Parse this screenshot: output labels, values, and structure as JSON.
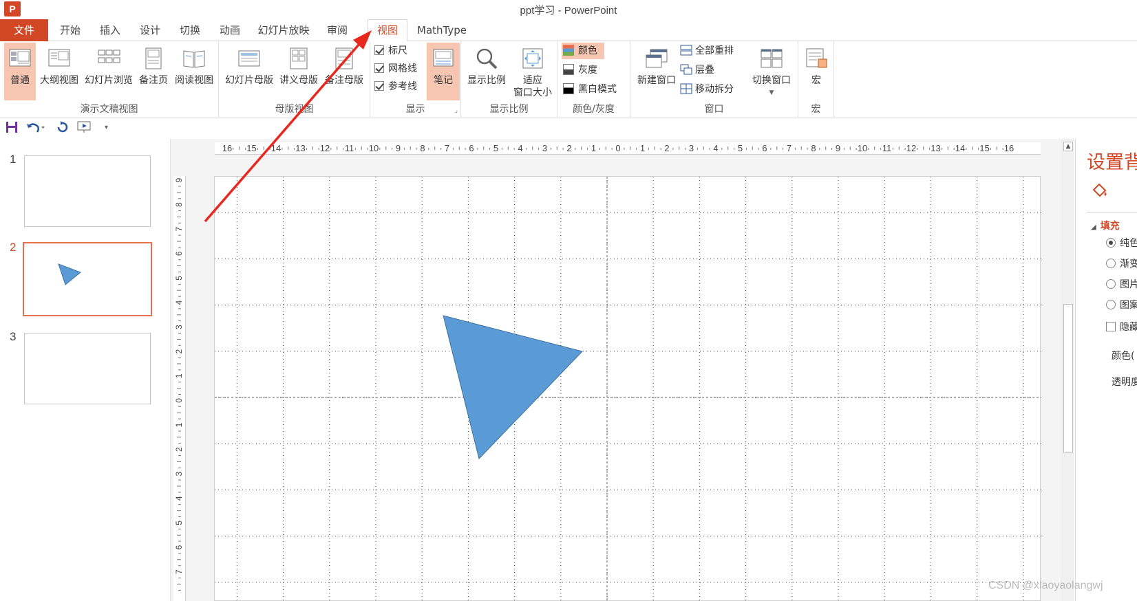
{
  "window": {
    "title": "ppt学习 - PowerPoint",
    "logo": "P"
  },
  "tabs": [
    {
      "label": "文件"
    },
    {
      "label": "开始"
    },
    {
      "label": "插入"
    },
    {
      "label": "设计"
    },
    {
      "label": "切换"
    },
    {
      "label": "动画"
    },
    {
      "label": "幻灯片放映"
    },
    {
      "label": "审阅"
    },
    {
      "label": "视图"
    },
    {
      "label": "MathType"
    }
  ],
  "active_tab": "视图",
  "ribbon": {
    "presentation_views": {
      "label": "演示文稿视图",
      "buttons": [
        "普通",
        "大纲视图",
        "幻灯片浏览",
        "备注页",
        "阅读视图"
      ]
    },
    "master_views": {
      "label": "母版视图",
      "buttons": [
        "幻灯片母版",
        "讲义母版",
        "备注母版"
      ]
    },
    "show": {
      "label": "显示",
      "checks": [
        "标尺",
        "网格线",
        "参考线"
      ],
      "notes": "笔记"
    },
    "zoom": {
      "label": "显示比例",
      "zoom_btn": "显示比例",
      "fit_line1": "适应",
      "fit_line2": "窗口大小"
    },
    "color": {
      "label": "颜色/灰度",
      "options": [
        "颜色",
        "灰度",
        "黑白模式"
      ]
    },
    "window": {
      "label": "窗口",
      "new_window": "新建窗口",
      "arrange_all": "全部重排",
      "cascade": "层叠",
      "move_split": "移动拆分",
      "switch": "切换窗口"
    },
    "macros": {
      "label": "宏",
      "button": "宏"
    }
  },
  "slides": [
    {
      "number": "1"
    },
    {
      "number": "2"
    },
    {
      "number": "3"
    }
  ],
  "selected_slide": "2",
  "ruler": {
    "h_ticks": [
      "16",
      "15",
      "14",
      "13",
      "12",
      "11",
      "10",
      "9",
      "8",
      "7",
      "6",
      "5",
      "4",
      "3",
      "2",
      "1",
      "0",
      "1",
      "2",
      "3",
      "4",
      "5",
      "6",
      "7",
      "8",
      "9",
      "10",
      "11",
      "12",
      "13",
      "14",
      "15",
      "16"
    ],
    "v_ticks": [
      "9",
      "8",
      "7",
      "6",
      "5",
      "4",
      "3",
      "2",
      "1",
      "0",
      "1",
      "2",
      "3",
      "4",
      "5",
      "6",
      "7"
    ]
  },
  "shape": {
    "type": "triangle",
    "fill": "#5b9bd5",
    "stroke": "#41719c"
  },
  "format_pane": {
    "title": "设置背",
    "section": "填充",
    "options": [
      {
        "label": "纯色",
        "type": "radio",
        "checked": true
      },
      {
        "label": "渐变",
        "type": "radio",
        "checked": false
      },
      {
        "label": "图片",
        "type": "radio",
        "checked": false
      },
      {
        "label": "图案",
        "type": "radio",
        "checked": false
      },
      {
        "label": "隐藏",
        "type": "checkbox",
        "checked": false
      }
    ],
    "color_label": "颜色(",
    "transparency_label": "透明度"
  },
  "colors": {
    "accent": "#d24726",
    "selected_bg": "#f7c6b2",
    "arrow": "#e8281e"
  },
  "watermark": "CSDN @xiaoyaolangwj"
}
